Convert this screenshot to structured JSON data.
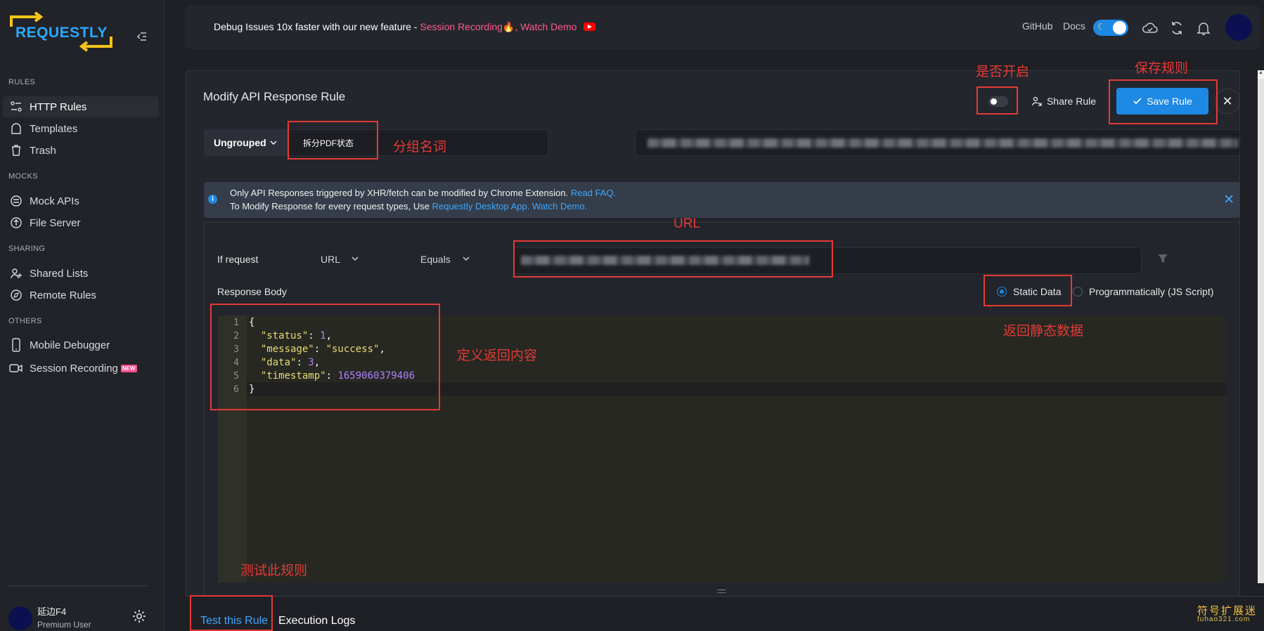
{
  "brand": {
    "logo_text": "REQUESTLY"
  },
  "sidebar": {
    "sections": {
      "rules": "RULES",
      "mocks": "MOCKS",
      "sharing": "SHARING",
      "others": "OTHERS"
    },
    "items": [
      {
        "label": "HTTP Rules",
        "icon": "rules-icon",
        "active": true
      },
      {
        "label": "Templates",
        "icon": "templates-icon"
      },
      {
        "label": "Trash",
        "icon": "trash-icon"
      },
      {
        "label": "Mock APIs",
        "icon": "mock-api-icon"
      },
      {
        "label": "File Server",
        "icon": "file-server-icon"
      },
      {
        "label": "Shared Lists",
        "icon": "shared-lists-icon"
      },
      {
        "label": "Remote Rules",
        "icon": "remote-rules-icon"
      },
      {
        "label": "Mobile Debugger",
        "icon": "mobile-icon"
      },
      {
        "label": "Session Recording",
        "icon": "video-icon",
        "badge": "NEW"
      }
    ],
    "user": {
      "name": "延边F4",
      "role": "Premium User"
    }
  },
  "topbar": {
    "banner_text": "Debug Issues 10x faster with our new feature -",
    "banner_link_1": "Session Recording🔥",
    "banner_link_sep": ", ",
    "banner_link_2": "Watch Demo",
    "github": "GitHub",
    "docs": "Docs",
    "theme_icon": "moon-icon",
    "accent_color": "#1e88e5"
  },
  "rule_editor": {
    "title": "Modify API Response Rule",
    "share_label": "Share Rule",
    "save_label": "Save Rule",
    "close_symbol": "✕",
    "group_label": "Ungrouped",
    "group_name": "拆分PDF状态",
    "info_line_1": "Only API Responses triggered by XHR/fetch can be modified by Chrome Extension.",
    "info_link_1": "Read FAQ.",
    "info_line_2": "To Modify Response for every request types, Use",
    "info_link_2": "Requestly Desktop App.",
    "info_link_3": "Watch Demo.",
    "if_request": "If request",
    "match_field": "URL",
    "match_operator": "Equals",
    "response_body_label": "Response Body",
    "response_type_options": [
      "Static Data",
      "Programmatically (JS Script)"
    ],
    "response_type_selected": "Static Data",
    "code_lines": [
      {
        "n": "1",
        "text": "{"
      },
      {
        "n": "2",
        "key": "\"status\"",
        "val": "1",
        "type": "num",
        "tail": ","
      },
      {
        "n": "3",
        "key": "\"message\"",
        "val": "\"success\"",
        "type": "str",
        "tail": ","
      },
      {
        "n": "4",
        "key": "\"data\"",
        "val": "3",
        "type": "num",
        "tail": ","
      },
      {
        "n": "5",
        "key": "\"timestamp\"",
        "val": "1659060379406",
        "type": "num",
        "tail": ""
      },
      {
        "n": "6",
        "text": "}"
      }
    ]
  },
  "bottom_tabs": {
    "test": "Test this Rule",
    "logs": "Execution Logs",
    "splitter": "::::::::"
  },
  "annotations": {
    "toggle": "是否开启",
    "save": "保存规则",
    "group": "分组名词",
    "url": "URL",
    "static": "返回静态数据",
    "content": "定义返回内容",
    "test": "测试此规则",
    "annotation_color": "#e53935"
  },
  "watermark": {
    "line1": "符号扩展迷",
    "line2": "fuhao321.com"
  }
}
